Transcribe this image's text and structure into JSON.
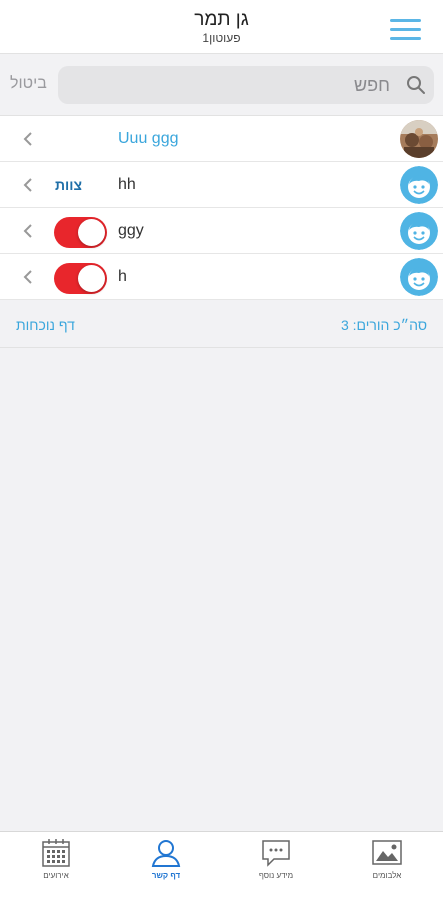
{
  "header": {
    "title": "גן תמר",
    "subtitle": "פעוטון1"
  },
  "search": {
    "placeholder": "חפש",
    "cancel_label": "ביטול"
  },
  "rows": [
    {
      "name": "Uuu ggg",
      "avatar": "photo-avatar",
      "is_link": true
    },
    {
      "name": "hh",
      "avatar": "child-face-icon",
      "tag": "צוות"
    },
    {
      "name": "ggy",
      "avatar": "child-face-icon",
      "toggle": true
    },
    {
      "name": "h",
      "avatar": "child-face-icon",
      "toggle": true
    }
  ],
  "summary": {
    "total_label": "סה״כ הורים: 3",
    "attendance_link": "דף נוכחות"
  },
  "tabs": [
    {
      "label": "אלבומים",
      "icon": "image-icon",
      "active": false
    },
    {
      "label": "מידע נוסף",
      "icon": "chat-icon",
      "active": false
    },
    {
      "label": "דף קשר",
      "icon": "person-icon",
      "active": true
    },
    {
      "label": "אירועים",
      "icon": "calendar-icon",
      "active": false
    }
  ],
  "colors": {
    "accent": "#3aa6dc",
    "toggle_on": "#e8262c",
    "active_tab": "#2176d2"
  }
}
